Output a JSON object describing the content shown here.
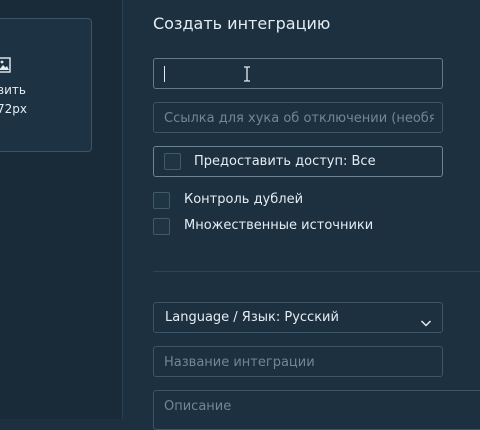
{
  "upload": {
    "text_line1": "вить",
    "text_line2": "72px"
  },
  "form": {
    "title": "Создать интеграцию",
    "hook_field": {
      "value": "",
      "placeholder": ""
    },
    "disconnect_hook": {
      "placeholder": "Ссылка для хука об отключении (необязательно)"
    },
    "access": {
      "label": "Предоставить доступ: Все",
      "checked": false
    },
    "duplicate_control": {
      "label": "Контроль дублей",
      "checked": false
    },
    "multiple_sources": {
      "label": "Множественные источники",
      "checked": false
    },
    "language": {
      "value": "Language / Язык: Русский"
    },
    "integration_name": {
      "placeholder": "Название интеграции"
    },
    "description": {
      "placeholder": "Описание"
    }
  },
  "colors": {
    "background": "#1c3040",
    "panel": "#192a38",
    "border": "#3b5668",
    "text": "#e6edf2",
    "placeholder": "#6f8797"
  }
}
